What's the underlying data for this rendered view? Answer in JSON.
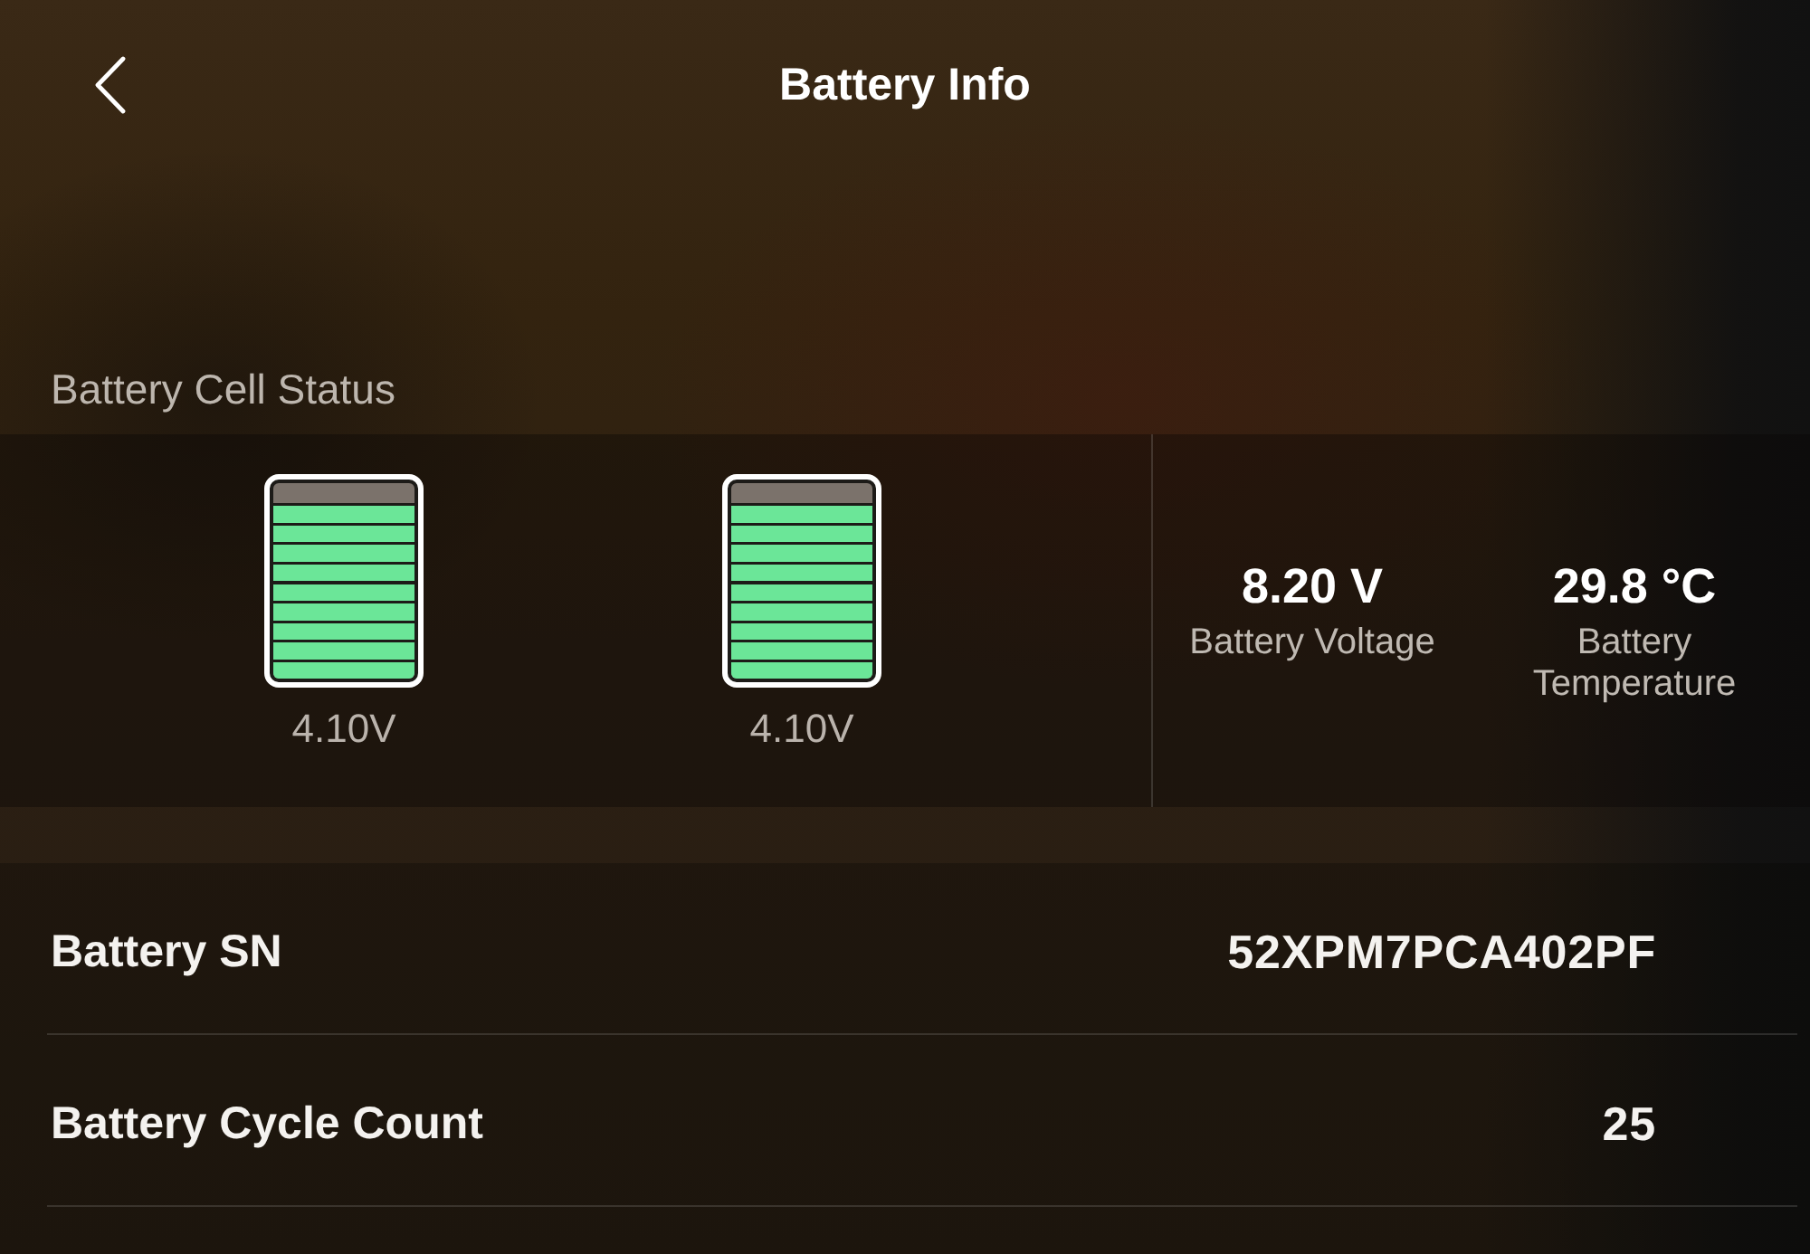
{
  "header": {
    "title": "Battery Info"
  },
  "cell_status": {
    "label": "Battery Cell Status",
    "cells": [
      {
        "level": 0.9,
        "reading": "4.10V"
      },
      {
        "level": 0.9,
        "reading": "4.10V"
      }
    ],
    "stats": [
      {
        "value": "8.20 V",
        "label": "Battery Voltage"
      },
      {
        "value": "29.8 °C",
        "label": "Battery Temperature"
      }
    ]
  },
  "details": [
    {
      "label": "Battery SN",
      "value": "52XPM7PCA402PF"
    },
    {
      "label": "Battery Cycle Count",
      "value": "25"
    }
  ]
}
